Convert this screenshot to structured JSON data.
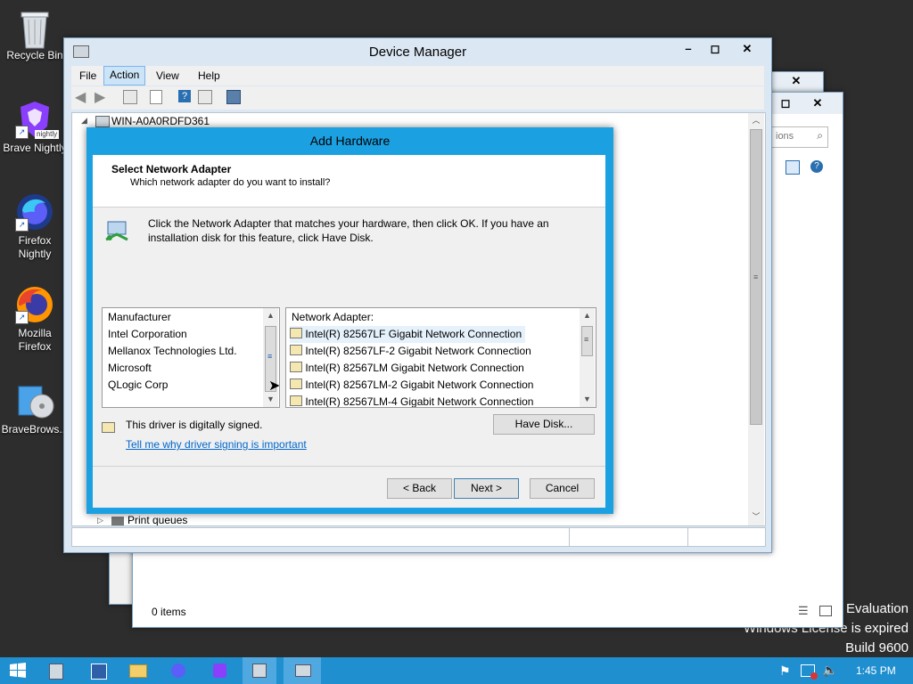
{
  "desktop": {
    "icons": [
      {
        "label": "Recycle Bin",
        "icon": "recycle-bin-icon"
      },
      {
        "label": "Brave Nightly",
        "icon": "brave-nightly-icon",
        "badge": "nightly"
      },
      {
        "label": "Firefox Nightly",
        "icon": "firefox-nightly-icon"
      },
      {
        "label": "Mozilla Firefox",
        "icon": "firefox-icon"
      },
      {
        "label": "BraveBrows...",
        "icon": "installer-icon"
      }
    ],
    "watermark": {
      "line1": "Evaluation",
      "line2": "Windows License is expired",
      "line3": "Build 9600"
    }
  },
  "background_window": {
    "search_placeholder": "ions",
    "status": "0 items"
  },
  "device_manager": {
    "title": "Device Manager",
    "menu": [
      "File",
      "Action",
      "View",
      "Help"
    ],
    "active_menu": "Action",
    "tree_root": "WIN-A0A0RDFD361",
    "tree_item_partial": "Print queues"
  },
  "add_hardware": {
    "title": "Add Hardware",
    "heading": "Select Network Adapter",
    "subheading": "Which network adapter do you want to install?",
    "instruction": "Click the Network Adapter that matches your hardware, then click OK. If you have an installation disk for this feature, click Have Disk.",
    "manufacturer_header": "Manufacturer",
    "manufacturers": [
      "Intel Corporation",
      "Mellanox Technologies Ltd.",
      "Microsoft",
      "QLogic Corp"
    ],
    "adapter_header": "Network Adapter:",
    "adapters": [
      "Intel(R) 82567LF Gigabit Network Connection",
      "Intel(R) 82567LF-2 Gigabit Network Connection",
      "Intel(R) 82567LM Gigabit Network Connection",
      "Intel(R) 82567LM-2 Gigabit Network Connection",
      "Intel(R) 82567LM-4 Gigabit Network Connection"
    ],
    "signed_text": "This driver is digitally signed.",
    "signing_link": "Tell me why driver signing is important",
    "have_disk": "Have Disk...",
    "back": "< Back",
    "next": "Next >",
    "cancel": "Cancel"
  },
  "taskbar": {
    "clock": "1:45 PM",
    "accent": "#1f8fd0"
  }
}
